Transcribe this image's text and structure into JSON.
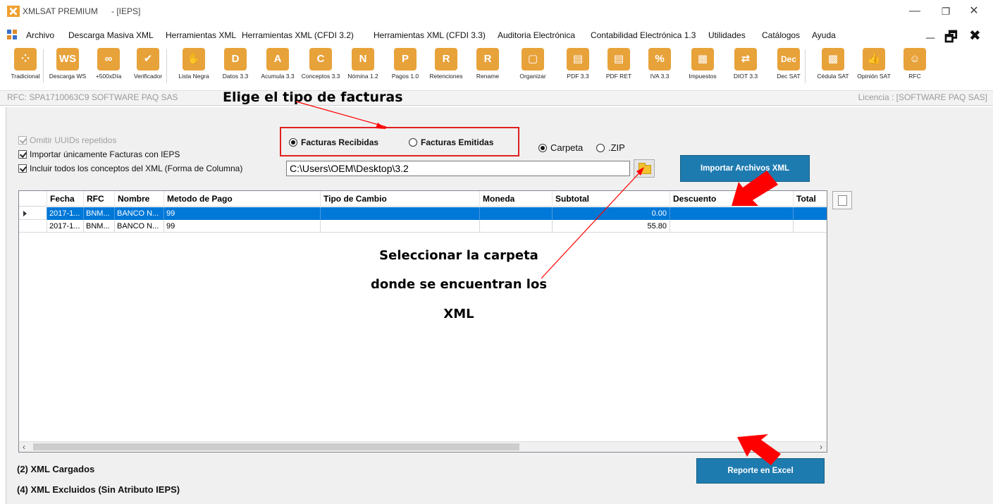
{
  "window": {
    "app_title": "XMLSAT PREMIUM",
    "document": "- [IEPS]",
    "min_symbol": "—",
    "max_symbol": "❐",
    "close_symbol": "✕"
  },
  "menu": {
    "items": [
      "Archivo",
      "Descarga Masiva XML",
      "Herramientas XML",
      "Herramientas XML (CFDI 3.2)",
      "Herramientas XML (CFDI 3.3)",
      "Auditoria Electrónica",
      "Contabilidad Electrónica 1.3",
      "Utilidades",
      "Catálogos",
      "Ayuda"
    ],
    "ctrl_min": "_",
    "ctrl_restore": "🗗",
    "ctrl_close": "✖"
  },
  "toolbar": {
    "tools": [
      {
        "label": "Tradicional",
        "glyph": "⁘",
        "color": "#e8a23a"
      },
      {
        "label": "Descarga WS",
        "glyph": "WS",
        "color": "#e8a23a"
      },
      {
        "label": "+500xDía",
        "glyph": "∞",
        "color": "#e8a23a"
      },
      {
        "label": "Verificador",
        "glyph": "✔",
        "color": "#e8a23a"
      },
      {
        "label": "Lista Negra",
        "glyph": "✋",
        "color": "#e8a23a"
      },
      {
        "label": "Datos 3.3",
        "glyph": "D",
        "color": "#e8a23a"
      },
      {
        "label": "Acumula 3.3",
        "glyph": "A",
        "color": "#e8a23a"
      },
      {
        "label": "Conceptos 3.3",
        "glyph": "C",
        "color": "#e8a23a"
      },
      {
        "label": "Nómina 1.2",
        "glyph": "N",
        "color": "#e8a23a"
      },
      {
        "label": "Pagos 1.0",
        "glyph": "P",
        "color": "#e8a23a"
      },
      {
        "label": "Retenciones",
        "glyph": "R",
        "color": "#e8a23a"
      },
      {
        "label": "Rename",
        "glyph": "R",
        "color": "#e8a23a"
      },
      {
        "label": "Organizar",
        "glyph": "▢",
        "color": "#e8a23a"
      },
      {
        "label": "PDF 3.3",
        "glyph": "▤",
        "color": "#e8a23a"
      },
      {
        "label": "PDF RET",
        "glyph": "▤",
        "color": "#e8a23a"
      },
      {
        "label": "IVA 3.3",
        "glyph": "%",
        "color": "#e8a23a"
      },
      {
        "label": "Impuestos",
        "glyph": "▦",
        "color": "#e8a23a"
      },
      {
        "label": "DIOT 3.3",
        "glyph": "⇄",
        "color": "#e8a23a"
      },
      {
        "label": "Dec SAT",
        "glyph": "Dec",
        "color": "#e8a23a"
      },
      {
        "label": "Cédula SAT",
        "glyph": "▩",
        "color": "#e8a23a"
      },
      {
        "label": "Opinión SAT",
        "glyph": "👍",
        "color": "#e8a23a"
      },
      {
        "label": "RFC",
        "glyph": "☺",
        "color": "#e8a23a"
      }
    ]
  },
  "rfc_bar": {
    "rfc": "RFC: SPA1710063C9 SOFTWARE PAQ SAS",
    "license": "Licencia : [SOFTWARE PAQ SAS]"
  },
  "options": {
    "omitir": "Omitir UUIDs repetidos",
    "importar": "Importar únicamente  Facturas con IEPS",
    "incluir": "Incluir todos los conceptos  del XML (Forma de Columna)"
  },
  "tipo": {
    "recibidas": "Facturas Recibidas",
    "emitidas": "Facturas Emitidas",
    "selected": "recibidas"
  },
  "source": {
    "carpeta": "Carpeta",
    "zip": ".ZIP",
    "selected": "carpeta",
    "path": "C:\\Users\\OEM\\Desktop\\3.2"
  },
  "buttons": {
    "importar": "Importar Archivos  XML",
    "reporte": "Reporte en Excel"
  },
  "grid": {
    "columns": [
      "Fecha",
      "RFC",
      "Nombre",
      "Metodo de Pago",
      "Tipo de Cambio",
      "Moneda",
      "Subtotal",
      "Descuento",
      "Total"
    ],
    "rows": [
      {
        "fecha": "2017-1...",
        "rfc": "BNM...",
        "nombre": "BANCO N...",
        "metodo": "99",
        "tipo_cambio": "",
        "moneda": "",
        "subtotal": "0.00",
        "descuento": "",
        "total": ""
      },
      {
        "fecha": "2017-1...",
        "rfc": "BNM...",
        "nombre": "BANCO N...",
        "metodo": "99",
        "tipo_cambio": "",
        "moneda": "",
        "subtotal": "55.80",
        "descuento": "",
        "total": ""
      }
    ],
    "scroll_left": "‹",
    "scroll_right": "›"
  },
  "status": {
    "cargados": "(2) XML Cargados",
    "excluidos": "(4) XML Excluidos (Sin Atributo IEPS)"
  },
  "annotations": {
    "elige": "Elige el tipo de facturas",
    "callout": [
      "Seleccionar la carpeta",
      "donde se encuentran los",
      "XML"
    ],
    "arrow_color": "#ff0000"
  }
}
